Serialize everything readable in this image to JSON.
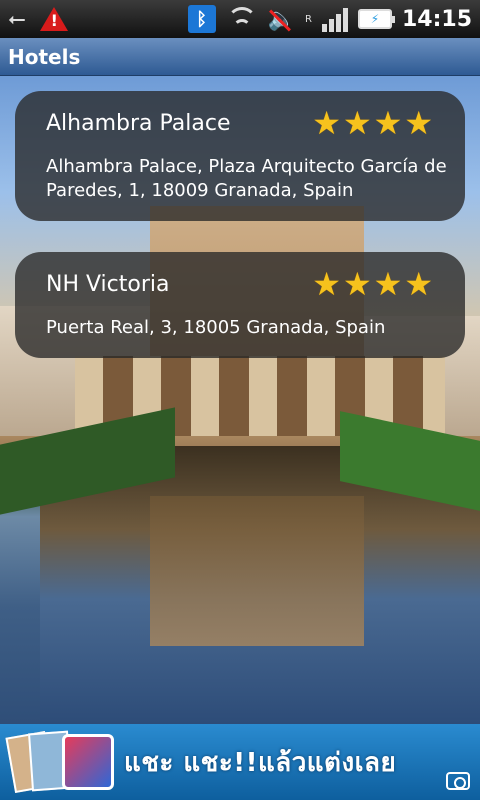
{
  "status_bar": {
    "time": "14:15",
    "icons": [
      "usb-icon",
      "warning-icon",
      "bluetooth-icon",
      "wifi-icon",
      "mute-icon",
      "signal-icon",
      "battery-charging-icon"
    ],
    "network_letter": "R"
  },
  "title_bar": {
    "title": "Hotels"
  },
  "hotels": [
    {
      "name": "Alhambra Palace",
      "rating": 4,
      "address": "Alhambra Palace, Plaza Arquitecto García de Paredes, 1, 18009 Granada, Spain"
    },
    {
      "name": "NH Victoria",
      "rating": 4,
      "address": "Puerta Real, 3, 18005 Granada, Spain"
    }
  ],
  "ad_banner": {
    "text": "แชะ แชะ!!แล้วแต่งเลย"
  },
  "colors": {
    "title_bar": "#2e5a93",
    "star": "#f6c21d",
    "card_bg": "rgba(40,40,40,0.78)",
    "ad_bg": "#1a74b8"
  }
}
